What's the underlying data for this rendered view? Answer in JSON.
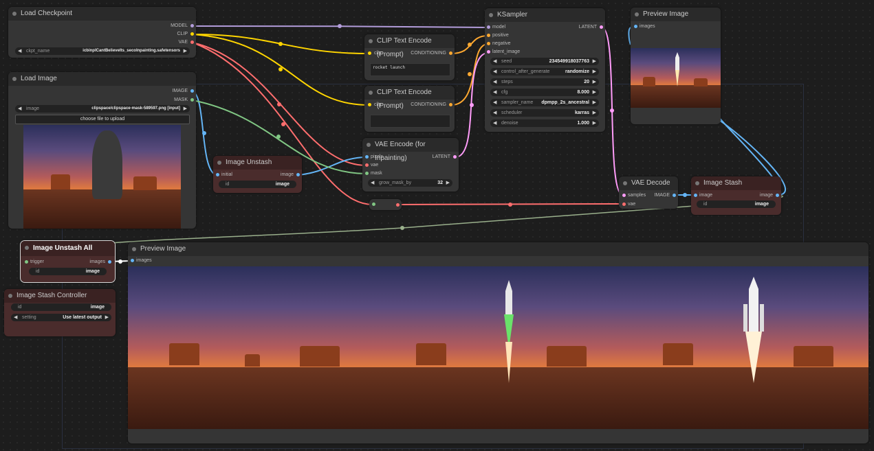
{
  "nodes": {
    "load_checkpoint": {
      "title": "Load Checkpoint",
      "outputs": [
        "MODEL",
        "CLIP",
        "VAE"
      ],
      "widget_label": "ckpt_name",
      "widget_value": "icbinpICantBelieveIts_seco‍Inpainting.safetensors"
    },
    "load_image": {
      "title": "Load Image",
      "outputs": [
        "IMAGE",
        "MASK"
      ],
      "widget_label": "image",
      "widget_value": "clipspace/clipspace-mask-589597.png [input]",
      "upload_label": "choose file to upload"
    },
    "clip_pos": {
      "title": "CLIP Text Encode (Prompt)",
      "input": "clip",
      "output": "CONDITIONING",
      "text": "rocket launch"
    },
    "clip_neg": {
      "title": "CLIP Text Encode (Prompt)",
      "input": "clip",
      "output": "CONDITIONING",
      "text": ""
    },
    "ksampler": {
      "title": "KSampler",
      "inputs": [
        "model",
        "positive",
        "negative",
        "latent_image"
      ],
      "output": "LATENT",
      "widgets": [
        {
          "label": "seed",
          "value": "234549918037763"
        },
        {
          "label": "control_after_generate",
          "value": "randomize"
        },
        {
          "label": "steps",
          "value": "20"
        },
        {
          "label": "cfg",
          "value": "8.000"
        },
        {
          "label": "sampler_name",
          "value": "dpmpp_2s_ancestral"
        },
        {
          "label": "scheduler",
          "value": "karras"
        },
        {
          "label": "denoise",
          "value": "1.000"
        }
      ]
    },
    "preview_top": {
      "title": "Preview Image",
      "input": "images"
    },
    "vae_encode": {
      "title": "VAE Encode (for Inpainting)",
      "inputs": [
        "pixels",
        "vae",
        "mask"
      ],
      "output": "LATENT",
      "widget_label": "grow_mask_by",
      "widget_value": "32"
    },
    "image_unstash": {
      "title": "Image Unstash",
      "input": "initial",
      "output": "image",
      "widget_label": "id",
      "widget_value": "image"
    },
    "vae_decode": {
      "title": "VAE Decode",
      "inputs": [
        "samples",
        "vae"
      ],
      "output": "IMAGE"
    },
    "image_stash": {
      "title": "Image Stash",
      "input": "image",
      "output": "image",
      "widget_label": "id",
      "widget_value": "image"
    },
    "unstash_all": {
      "title": "Image Unstash All",
      "input": "trigger",
      "output": "images",
      "widget_label": "id",
      "widget_value": "image"
    },
    "stash_controller": {
      "title": "Image Stash Controller",
      "widgets": [
        {
          "label": "id",
          "value": "image"
        },
        {
          "label": "setting",
          "value": "Use latest output"
        }
      ]
    },
    "preview_bottom": {
      "title": "Preview Image",
      "input": "images"
    }
  },
  "colors": {
    "model": "#b39ddb",
    "clip": "#ffd500",
    "vae": "#ff6e6e",
    "image": "#64b5f6",
    "mask": "#81c784",
    "latent": "#ff9cf9",
    "conditioning": "#ffa931"
  }
}
